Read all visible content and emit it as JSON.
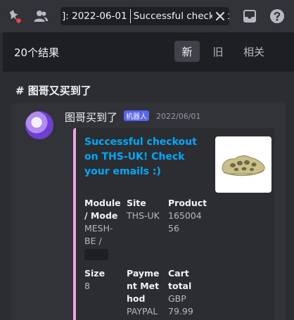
{
  "toolbar": {
    "pin_icon": "pin-icon",
    "members_icon": "members-icon",
    "inbox_icon": "inbox-icon",
    "help_icon": "help-icon"
  },
  "search": {
    "chip_text": "]: 2022-06-01",
    "query_text": "Successful checkout"
  },
  "results": {
    "count_label": "20个结果",
    "sort_tabs": [
      "新",
      "旧",
      "相关"
    ],
    "active_tab": "新"
  },
  "channel": {
    "name": "# 图哥又买到了"
  },
  "message": {
    "author": "图哥买到了",
    "bot_tag": "机器人",
    "timestamp": "2022/06/01",
    "embed": {
      "accent_color": "#e9a6e5",
      "title": "Successful checkout on THS-UK! Check your emails :)",
      "fields": [
        {
          "name": "Module / Mode",
          "value": "MESH-BE /"
        },
        {
          "name": "Site",
          "value": "THS-UK"
        },
        {
          "name": "Product",
          "value": "16500456"
        },
        {
          "name": "Size",
          "value": "8"
        },
        {
          "name": "Payment Method",
          "value": "PAYPAL"
        },
        {
          "name": "Cart total",
          "value": "GBP 79.99"
        }
      ]
    }
  }
}
